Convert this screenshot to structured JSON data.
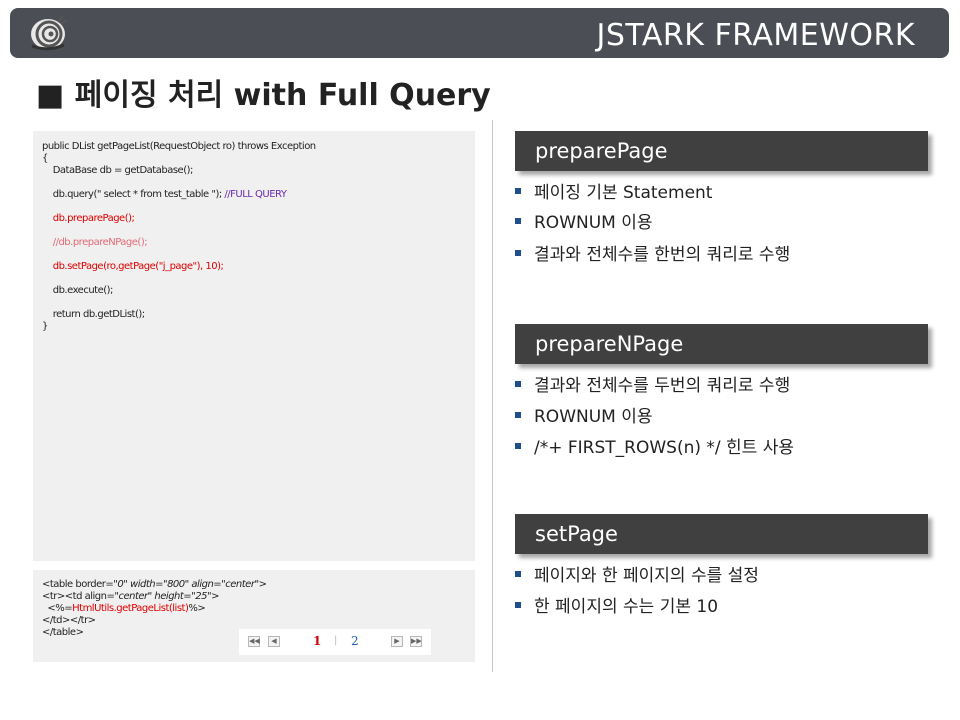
{
  "header": {
    "brand": "JSTARK FRAMEWORK",
    "logo_icon": "snail-logo-icon"
  },
  "title": "■ 페이징 처리 with Full Query",
  "code": {
    "lines": [
      "public DList getPageList(RequestObject ro) throws Exception",
      "{",
      "    DataBase db = getDatabase();",
      "    db.query(\" select * from test_table \"); ",
      "    db.preparePage();",
      "    //db.prepareNPage();",
      "    db.setPage(ro,getPage(\"j_page\"), 10);",
      "    db.execute();",
      "    return db.getDList();",
      "}"
    ],
    "comment": "//FULL QUERY"
  },
  "html_snippet": {
    "line1_a": "<table border=",
    "line1_b": "\"0\" width=\"800\" align=\"center\"",
    "line1_c": ">",
    "line2_a": "<tr><td align=",
    "line2_b": "\"center\" height=\"25\"",
    "line2_c": ">",
    "line3_a": "  <%=",
    "line3_b": "HtmlUtils.getPageList(list)",
    "line3_c": "%>",
    "line4": "</td></tr>",
    "line5": "</table>"
  },
  "pager": {
    "first": "◀◀",
    "prev": "◀",
    "current": "1",
    "sep": "|",
    "page2": "2",
    "next": "▶",
    "last": "▶▶"
  },
  "sections": [
    {
      "title": "preparePage",
      "bullets": [
        "페이징 기본 Statement",
        "ROWNUM 이용",
        "결과와 전체수를 한번의 쿼리로 수행"
      ]
    },
    {
      "title": "prepareNPage",
      "bullets": [
        "결과와 전체수를 두번의 쿼리로 수행",
        "ROWNUM 이용",
        "/*+ FIRST_ROWS(n) */ 힌트 사용"
      ]
    },
    {
      "title": "setPage",
      "bullets": [
        "페이지와 한 페이지의 수를 설정",
        "한 페이지의 수는 기본 10"
      ]
    }
  ],
  "colors": {
    "header_bg": "#4b4e55",
    "section_bg": "#404040",
    "bullet": "#1f4e8c",
    "code_bg": "#f0f0f0"
  }
}
